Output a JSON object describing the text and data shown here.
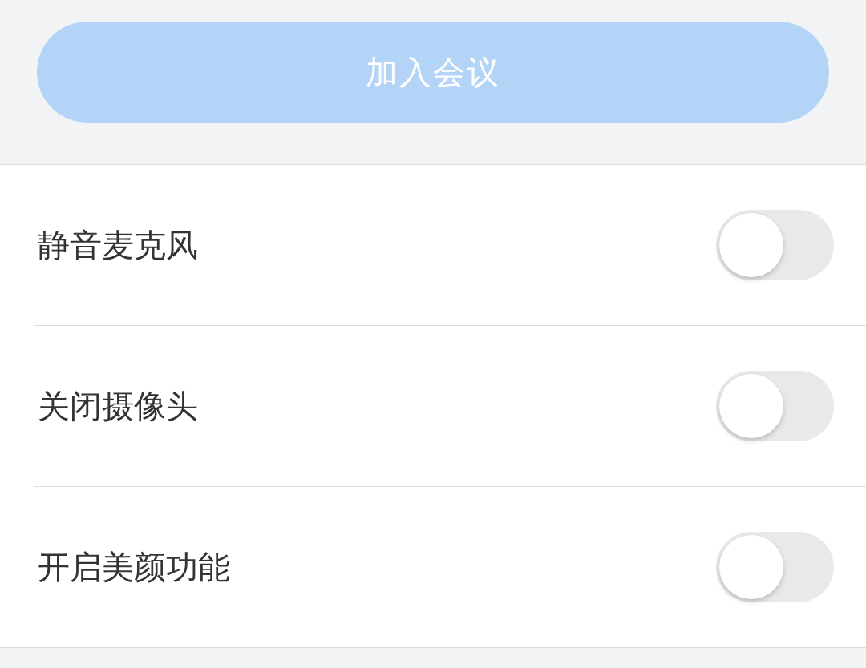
{
  "join_button": {
    "label": "加入会议",
    "disabled": true
  },
  "settings": [
    {
      "label": "静音麦克风",
      "on": false
    },
    {
      "label": "关闭摄像头",
      "on": false
    },
    {
      "label": "开启美颜功能",
      "on": false
    }
  ]
}
